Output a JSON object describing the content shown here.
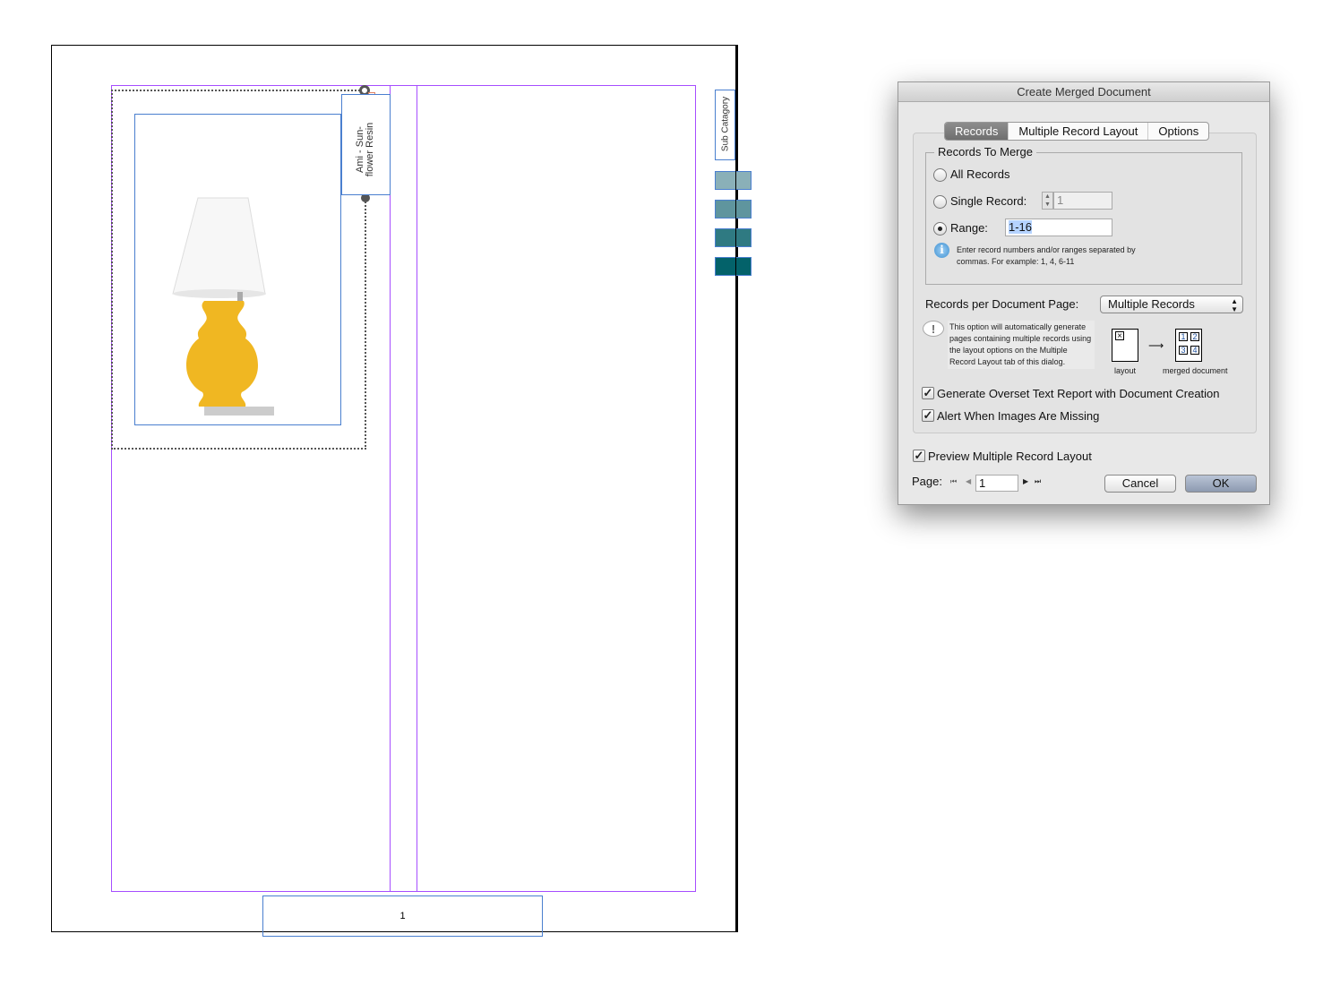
{
  "document": {
    "product_name_field": "Ami - Sun-flower Resin",
    "product_name_lines": [
      "Ami - Sun-",
      "flower Resin"
    ],
    "sub_category_field": "Sub Catagory",
    "page_number": "1",
    "swatch_colors": [
      "#8ab0b8",
      "#5f959e",
      "#2f7a82",
      "#03626a"
    ],
    "margin_color": "#a64dff",
    "frame_color": "#4a7fcf"
  },
  "dialog": {
    "title": "Create Merged Document",
    "tabs": [
      {
        "label": "Records",
        "active": true
      },
      {
        "label": "Multiple Record Layout",
        "active": false
      },
      {
        "label": "Options",
        "active": false
      }
    ],
    "records_group": {
      "legend": "Records To Merge",
      "all_records_label": "All Records",
      "single_record_label": "Single Record:",
      "single_record_value": "1",
      "range_label": "Range:",
      "range_value": "1-16",
      "selected": "Range",
      "hint": "Enter record numbers and/or ranges separated by commas. For example: 1, 4, 6-11"
    },
    "records_per_page_label": "Records per Document Page:",
    "records_per_page_value": "Multiple Records",
    "note": "This option will automatically generate pages containing multiple records using the layout options on the Multiple Record Layout tab of this dialog.",
    "diagram": {
      "layout_label": "layout",
      "merged_label": "merged document",
      "cells": [
        "1",
        "2",
        "3",
        "4"
      ]
    },
    "overset_label": "Generate Overset Text Report with Document Creation",
    "overset_checked": true,
    "missing_images_label": "Alert When Images Are Missing",
    "missing_images_checked": true,
    "preview_label": "Preview Multiple Record Layout",
    "preview_checked": true,
    "page_label": "Page:",
    "page_value": "1",
    "cancel_label": "Cancel",
    "ok_label": "OK"
  }
}
